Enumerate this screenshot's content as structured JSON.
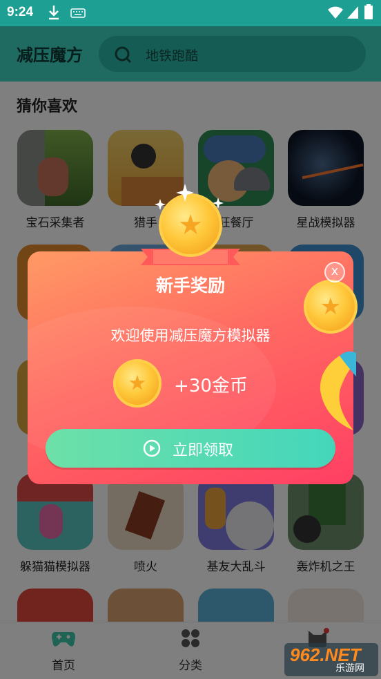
{
  "status_bar": {
    "time": "9:24"
  },
  "header": {
    "app_title": "减压魔方",
    "search_placeholder": "地铁跑酷"
  },
  "section": {
    "title": "猜你喜欢"
  },
  "games": [
    {
      "name": "宝石采集者"
    },
    {
      "name": "猎手"
    },
    {
      "name": "狂餐厅"
    },
    {
      "name": "星战模拟器"
    },
    {
      "name": ""
    },
    {
      "name": ""
    },
    {
      "name": ""
    },
    {
      "name": ""
    },
    {
      "name": ""
    },
    {
      "name": ""
    },
    {
      "name": ""
    },
    {
      "name": ""
    },
    {
      "name": "躲猫猫模拟器"
    },
    {
      "name": "喷火"
    },
    {
      "name": "基友大乱斗"
    },
    {
      "name": "轰炸机之王"
    }
  ],
  "bottom_nav": {
    "home": "首页",
    "category": "分类"
  },
  "dialog": {
    "title": "新手奖励",
    "message": "欢迎使用减压魔方模拟器",
    "reward": "+30金币",
    "claim_label": "立即领取",
    "close_label": "x"
  },
  "watermark": {
    "number": "962.NET",
    "sub": "乐游网"
  },
  "colors": {
    "header": "#3fd5c3",
    "status_bar": "#1e9f93",
    "dialog_start": "#ff9a64",
    "dialog_end": "#ff3f63",
    "claim": "#44d6bb"
  }
}
